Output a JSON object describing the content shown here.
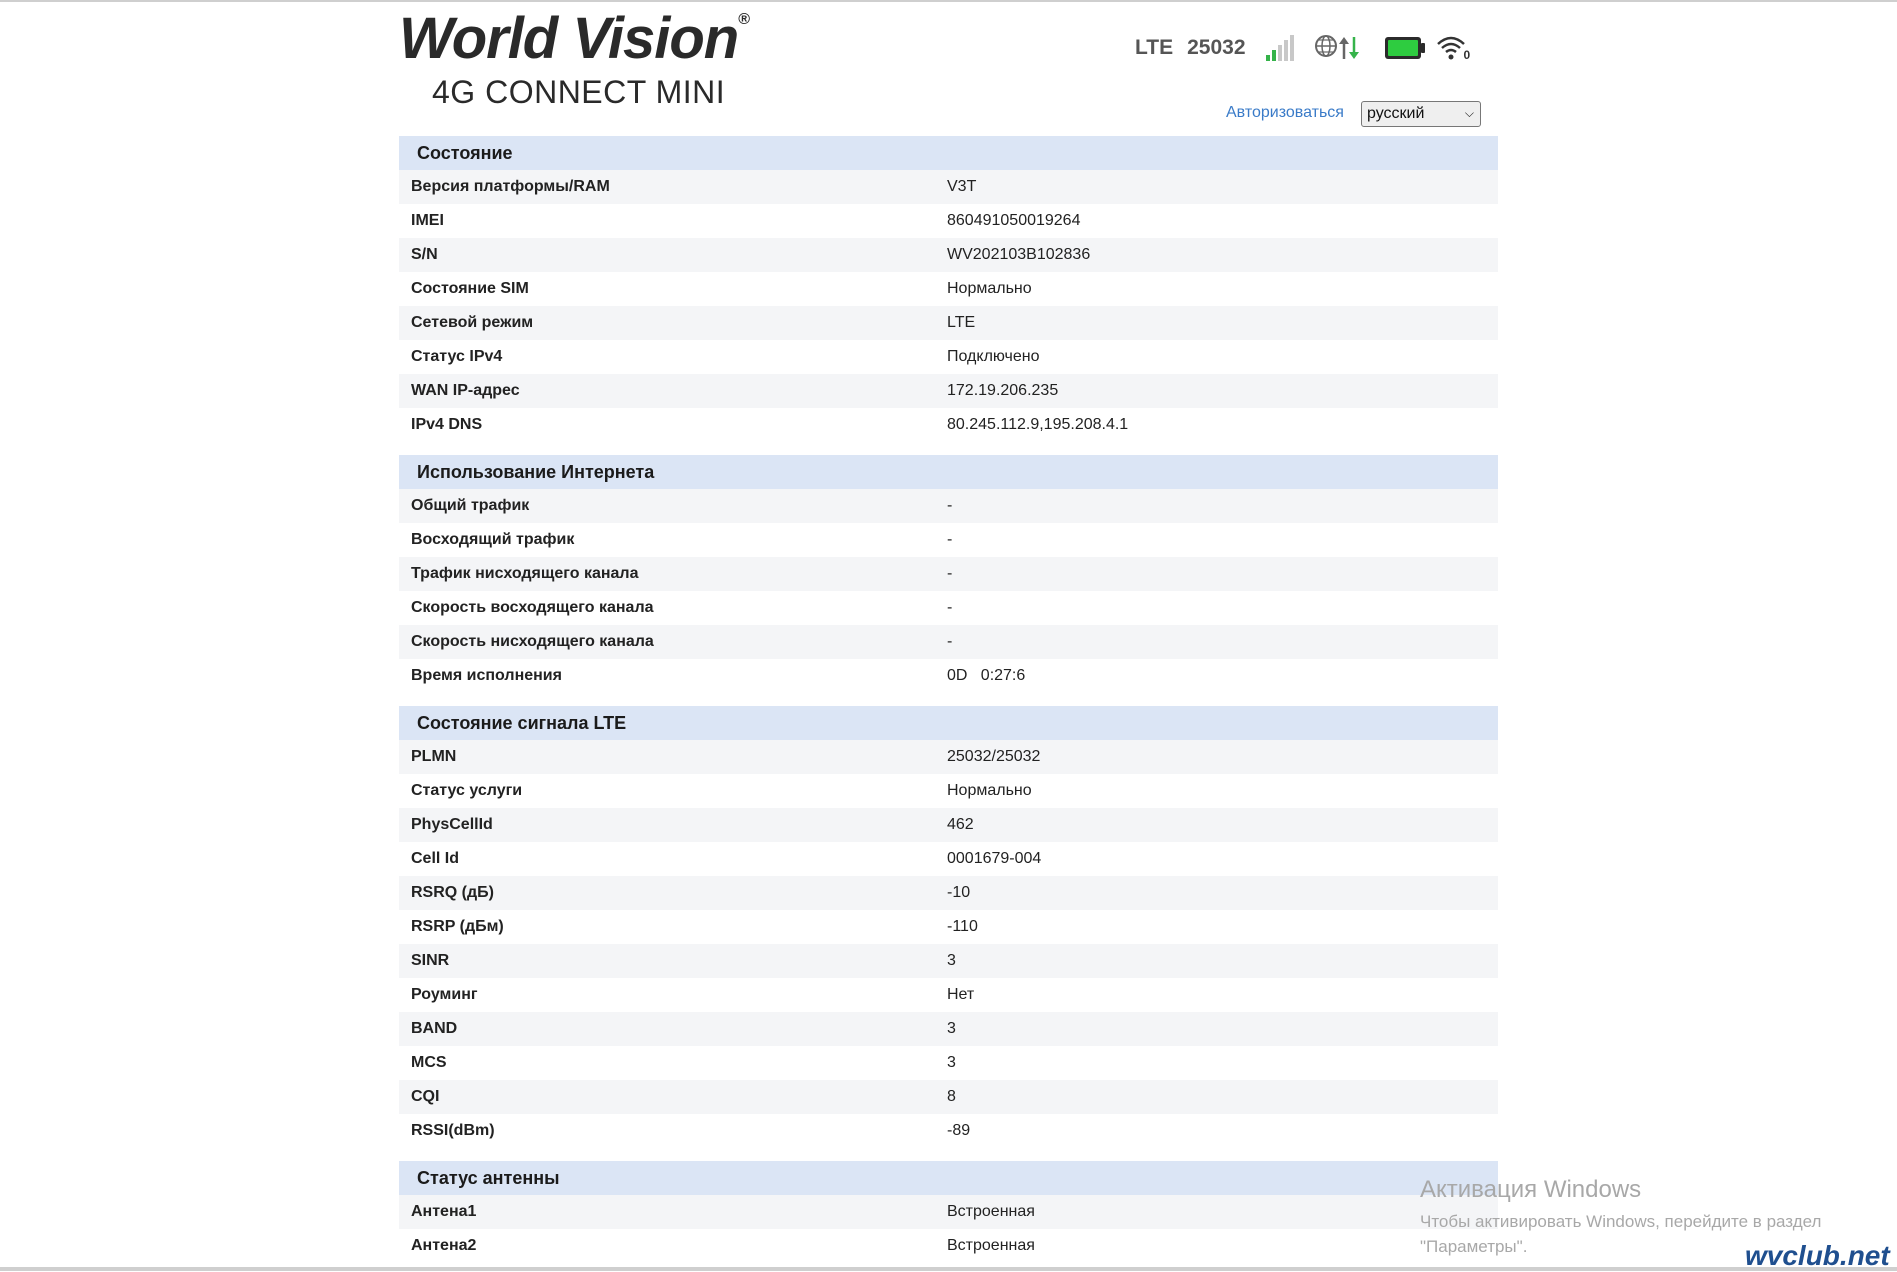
{
  "brand": {
    "name": "World Vision",
    "registered": "®",
    "model": "4G CONNECT MINI"
  },
  "status": {
    "network_type": "LTE",
    "operator_code": "25032",
    "wifi_clients": "0"
  },
  "header": {
    "login_label": "Авторизоваться",
    "language_selected": "русский"
  },
  "sections": {
    "device": {
      "title": "Состояние",
      "rows": [
        {
          "label": "Версия платформы/RAM",
          "value": "V3T"
        },
        {
          "label": "IMEI",
          "value": "860491050019264"
        },
        {
          "label": "S/N",
          "value": "WV202103B102836"
        },
        {
          "label": "Состояние SIM",
          "value": "Нормально"
        },
        {
          "label": "Сетевой режим",
          "value": "LTE"
        },
        {
          "label": "Статус IPv4",
          "value": "Подключено"
        },
        {
          "label": "WAN IP-адрес",
          "value": "172.19.206.235"
        },
        {
          "label": "IPv4 DNS",
          "value": "80.245.112.9,195.208.4.1"
        }
      ]
    },
    "internet": {
      "title": "Использование Интернета",
      "rows": [
        {
          "label": "Общий трафик",
          "value": "-"
        },
        {
          "label": "Восходящий трафик",
          "value": "-"
        },
        {
          "label": "Трафик нисходящего канала",
          "value": "-"
        },
        {
          "label": "Скорость восходящего канала",
          "value": "-"
        },
        {
          "label": "Скорость нисходящего канала",
          "value": "-"
        },
        {
          "label": "Время исполнения",
          "value": "0D   0:27:6"
        }
      ]
    },
    "lte": {
      "title": "Состояние сигнала LTE",
      "rows": [
        {
          "label": "PLMN",
          "value": "25032/25032"
        },
        {
          "label": "Статус услуги",
          "value": "Нормально"
        },
        {
          "label": "PhysCellId",
          "value": "462"
        },
        {
          "label": "Cell Id",
          "value": "0001679-004"
        },
        {
          "label": "RSRQ (дБ)",
          "value": "-10"
        },
        {
          "label": "RSRP (дБм)",
          "value": "-110"
        },
        {
          "label": "SINR",
          "value": "3"
        },
        {
          "label": "Роуминг",
          "value": "Нет"
        },
        {
          "label": "BAND",
          "value": "3"
        },
        {
          "label": "MCS",
          "value": "3"
        },
        {
          "label": "CQI",
          "value": "8"
        },
        {
          "label": "RSSI(dBm)",
          "value": "-89"
        }
      ]
    },
    "antenna": {
      "title": "Статус антенны",
      "rows": [
        {
          "label": "Антена1",
          "value": "Встроенная"
        },
        {
          "label": "Антена2",
          "value": "Встроенная"
        }
      ]
    }
  },
  "overlay": {
    "activation_title": "Активация Windows",
    "activation_text": "Чтобы активировать Windows, перейдите в раздел \"Параметры\".",
    "site_logo": "wvclub.net"
  },
  "colors": {
    "section_bg": "#dbe5f5",
    "row_alt_bg": "#f4f5f7",
    "link": "#3a7bc8",
    "signal_active": "#35b34a",
    "battery_fill": "#2ecc40"
  }
}
